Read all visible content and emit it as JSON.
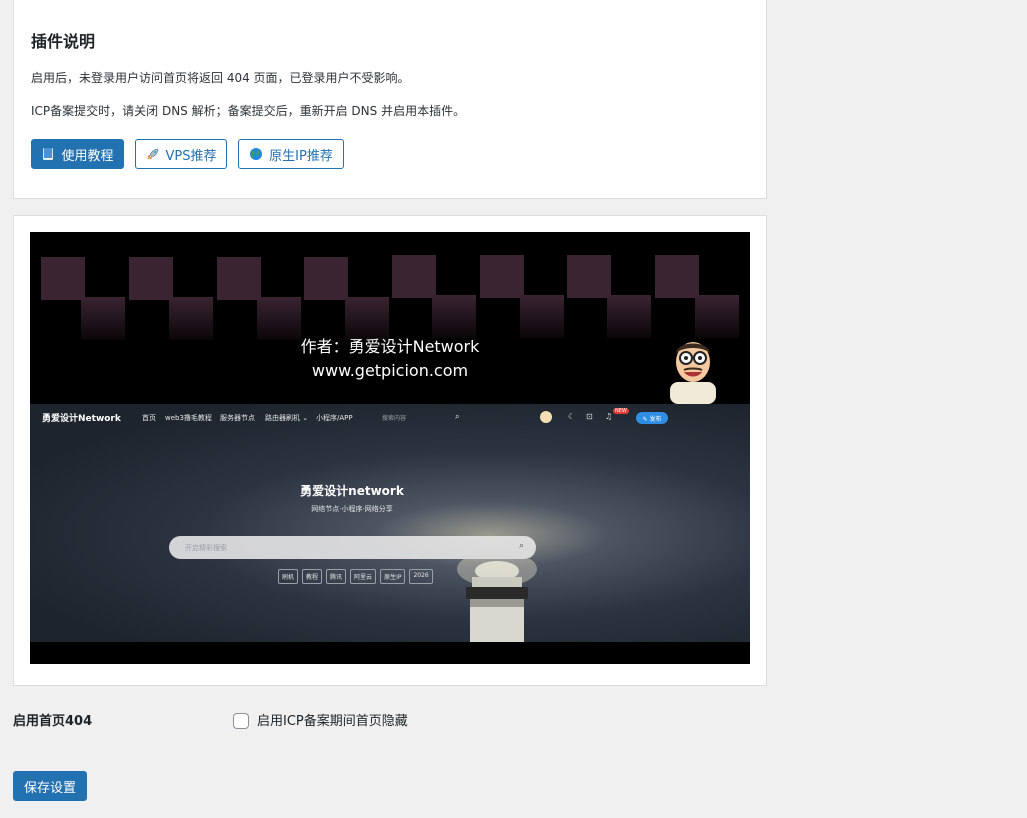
{
  "plugin_info": {
    "title": "插件说明",
    "line1": "启用后，未登录用户访问首页将返回 404 页面，已登录用户不受影响。",
    "line2": "ICP备案提交时，请关闭 DNS 解析；备案提交后，重新开启 DNS 并启用本插件。",
    "buttons": {
      "tutorial": {
        "label": "使用教程",
        "icon": "book-icon"
      },
      "vps": {
        "label": "VPS推荐",
        "icon": "rocket-icon"
      },
      "native_ip": {
        "label": "原生IP推荐",
        "icon": "globe-icon"
      }
    }
  },
  "banner": {
    "author": "作者：勇爱设计Network",
    "url": "www.getpicion.com",
    "site": {
      "logo": "勇爱设计Network",
      "nav": [
        "首页",
        "web3撸毛教程",
        "服务器节点",
        "路由器刷机 ⌄",
        "小程序/APP"
      ],
      "search_placeholder": "搜索内容",
      "badge": "NEW",
      "post_button": "✎ 发布",
      "hero_title": "勇爱设计network",
      "hero_subtitle": "网络节点·小程序·网络分享",
      "hero_search_placeholder": "开启精彩搜索",
      "tags": [
        "刷机",
        "教程",
        "腾讯",
        "阿里云",
        "原生IP",
        "2026"
      ]
    }
  },
  "settings": {
    "label": "启用首页404",
    "checkbox_label": "启用ICP备案期间首页隐藏",
    "checkbox_checked": false,
    "save_label": "保存设置"
  },
  "colors": {
    "primary": "#2271b1",
    "background": "#f0f0f1",
    "card": "#ffffff"
  }
}
